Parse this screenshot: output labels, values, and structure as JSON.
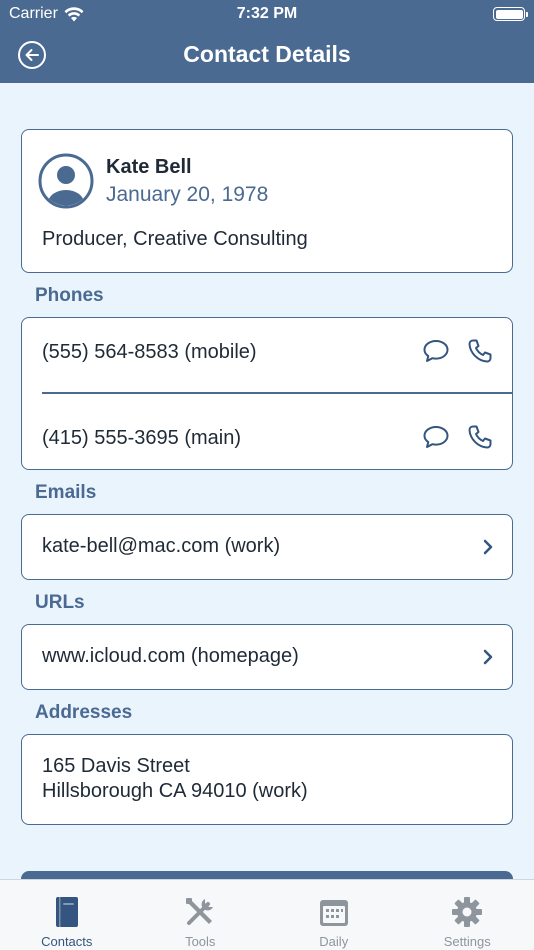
{
  "status_bar": {
    "carrier": "Carrier",
    "time": "7:32 PM"
  },
  "nav": {
    "title": "Contact Details",
    "back_icon": "back-arrow-circle-icon"
  },
  "contact": {
    "name": "Kate Bell",
    "birthday": "January 20, 1978",
    "job": "Producer, Creative Consulting"
  },
  "sections": {
    "phones": "Phones",
    "emails": "Emails",
    "urls": "URLs",
    "addresses": "Addresses"
  },
  "phones": [
    {
      "number": "(555) 564-8583  (mobile)"
    },
    {
      "number": "(415) 555-3695  (main)"
    }
  ],
  "emails": [
    {
      "value": "kate-bell@mac.com  (work)"
    }
  ],
  "urls": [
    {
      "value": "www.icloud.com  (homepage)"
    }
  ],
  "addresses": [
    {
      "line1": "165 Davis Street",
      "line2": "Hillsborough CA 94010 (work)"
    }
  ],
  "tabs": [
    {
      "label": "Contacts",
      "icon": "book-icon",
      "active": true
    },
    {
      "label": "Tools",
      "icon": "tools-icon",
      "active": false
    },
    {
      "label": "Daily",
      "icon": "calendar-icon",
      "active": false
    },
    {
      "label": "Settings",
      "icon": "gear-icon",
      "active": false
    }
  ],
  "colors": {
    "accent": "#4a6a92",
    "background": "#eaf4fc",
    "active_tab": "#33557f",
    "inactive_tab": "#8e959d"
  }
}
